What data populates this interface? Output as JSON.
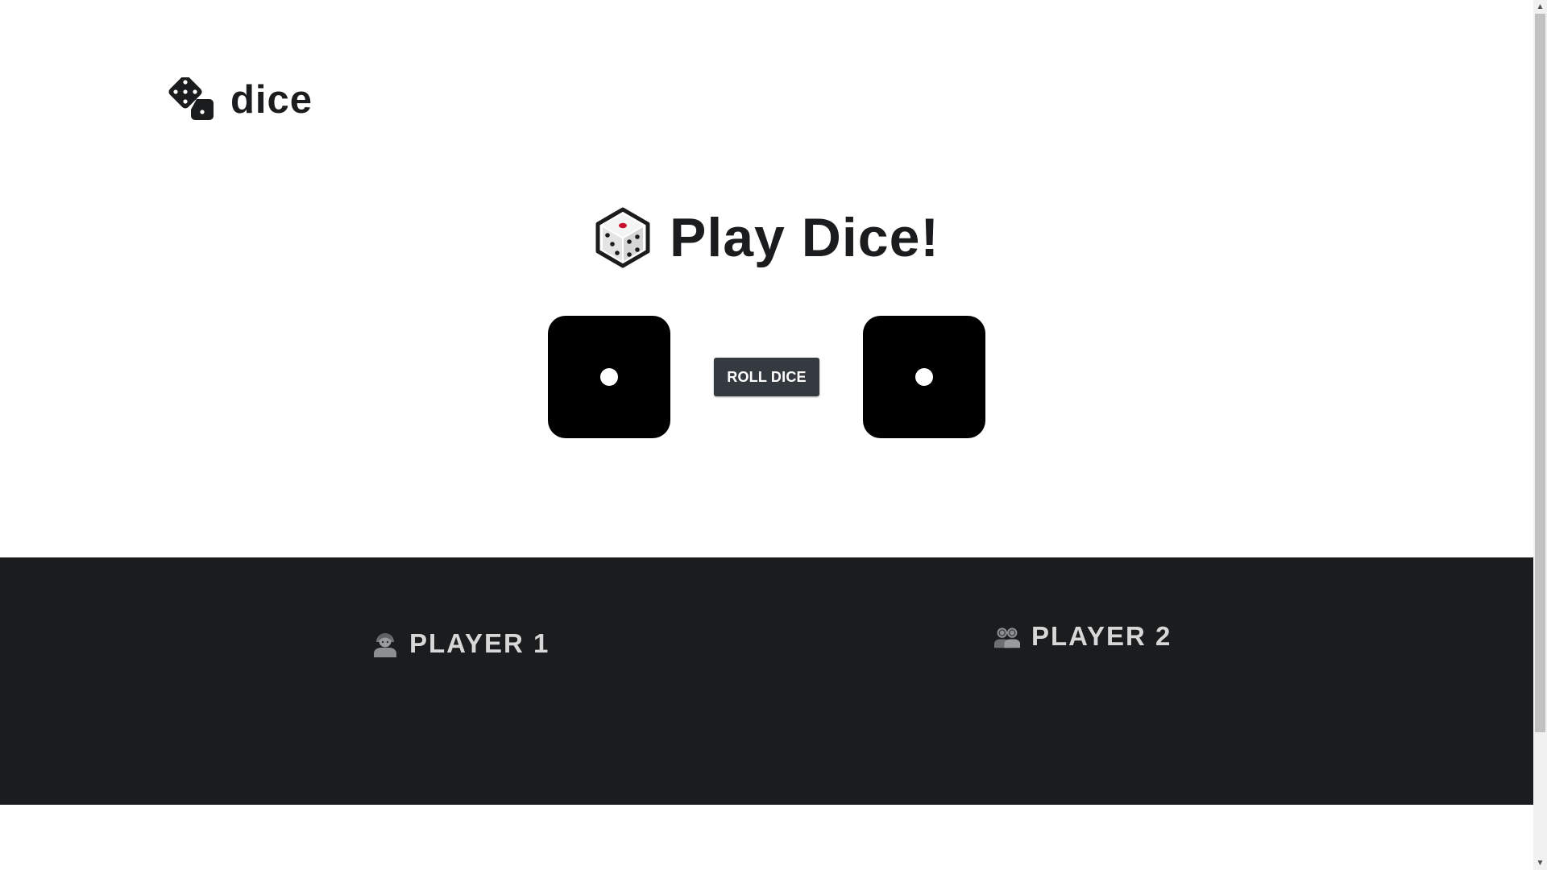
{
  "brand": {
    "name": "dice",
    "icon": "dice-icon"
  },
  "title": {
    "text": "Play Dice!",
    "icon": "game-die-icon"
  },
  "dice": [
    {
      "value": 1
    },
    {
      "value": 1
    }
  ],
  "roll_button": {
    "label": "ROLL DICE"
  },
  "players": [
    {
      "name": "PLAYER 1",
      "icon": "person-icon"
    },
    {
      "name": "PLAYER 2",
      "icon": "two-people-icon"
    }
  ],
  "colors": {
    "text_dark": "#1b1c1e",
    "die": "#000000",
    "button": "#353a41",
    "players_band": "#1b1c1e",
    "player_text": "#d7d7d7"
  }
}
